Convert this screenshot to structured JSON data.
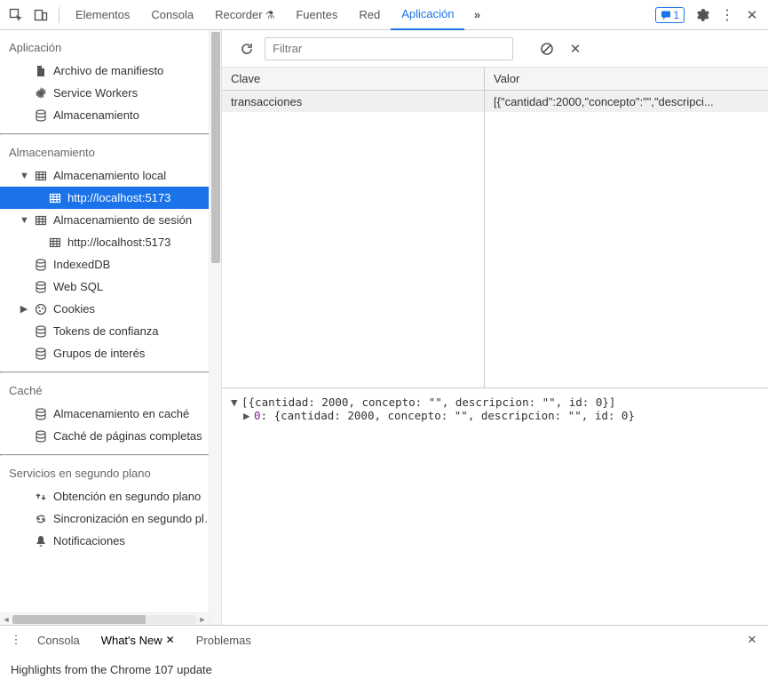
{
  "tabs": {
    "elements": "Elementos",
    "console": "Consola",
    "recorder": "Recorder",
    "sources": "Fuentes",
    "network": "Red",
    "application": "Aplicación"
  },
  "badge_count": "1",
  "sidebar": {
    "section_app": "Aplicación",
    "manifest": "Archivo de manifiesto",
    "sw": "Service Workers",
    "storage": "Almacenamiento",
    "section_storage": "Almacenamiento",
    "local_storage": "Almacenamiento local",
    "local_origin": "http://localhost:5173",
    "session_storage": "Almacenamiento de sesión",
    "session_origin": "http://localhost:5173",
    "indexeddb": "IndexedDB",
    "websql": "Web SQL",
    "cookies": "Cookies",
    "trust_tokens": "Tokens de confianza",
    "interest_groups": "Grupos de interés",
    "section_cache": "Caché",
    "cache_storage": "Almacenamiento en caché",
    "cache_pages": "Caché de páginas completas",
    "section_bg": "Servicios en segundo plano",
    "bg_fetch": "Obtención en segundo plano",
    "bg_sync": "Sincronización en segundo plano",
    "notifications": "Notificaciones"
  },
  "toolbar": {
    "filter_placeholder": "Filtrar"
  },
  "table": {
    "head_key": "Clave",
    "head_val": "Valor",
    "rows": [
      {
        "key": "transacciones",
        "val": "[{\"cantidad\":2000,\"concepto\":\"\",\"descripci..."
      }
    ]
  },
  "preview": {
    "line0": "[{cantidad: 2000, concepto: \"\", descripcion: \"\", id: 0}]",
    "line1_idx": "0",
    "line1_text": ": {cantidad: 2000, concepto: \"\", descripcion: \"\", id: 0}"
  },
  "drawer": {
    "console": "Consola",
    "whatsnew": "What's New",
    "problems": "Problemas",
    "highlights": "Highlights from the Chrome 107 update"
  }
}
